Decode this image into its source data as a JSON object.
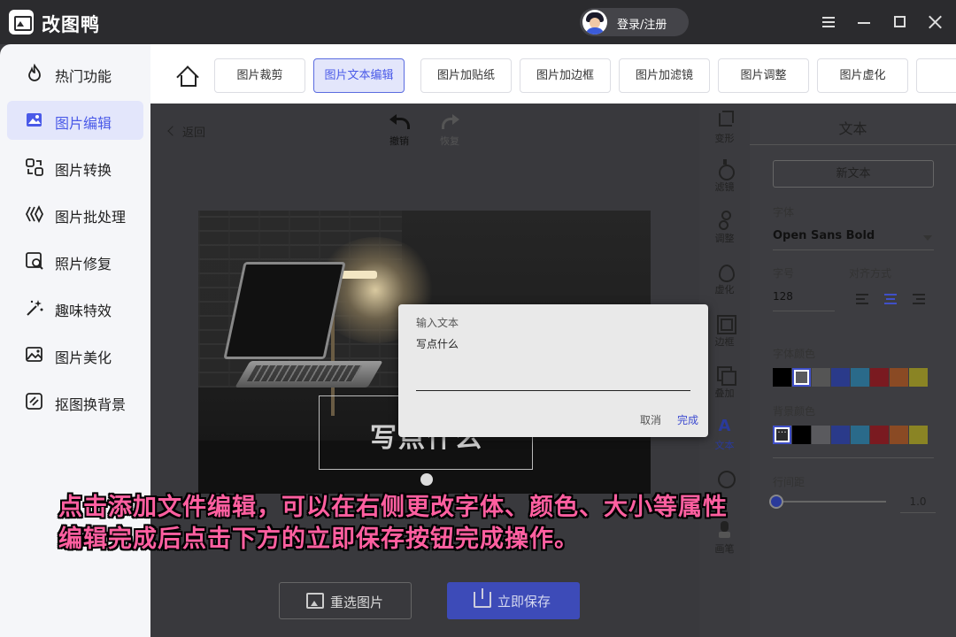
{
  "app": {
    "title": "改图鸭",
    "login_label": "登录/注册"
  },
  "sidebar": {
    "items": [
      {
        "label": "热门功能",
        "icon": "flame-icon"
      },
      {
        "label": "图片编辑",
        "icon": "image-edit-icon",
        "active": true
      },
      {
        "label": "图片转换",
        "icon": "convert-icon"
      },
      {
        "label": "图片批处理",
        "icon": "batch-icon"
      },
      {
        "label": "照片修复",
        "icon": "repair-icon"
      },
      {
        "label": "趣味特效",
        "icon": "magic-icon"
      },
      {
        "label": "图片美化",
        "icon": "beautify-icon"
      },
      {
        "label": "抠图换背景",
        "icon": "cutout-icon"
      }
    ]
  },
  "tabs": [
    {
      "label": "图片裁剪"
    },
    {
      "label": "图片文本编辑",
      "active": true
    },
    {
      "label": "图片加贴纸"
    },
    {
      "label": "图片加边框"
    },
    {
      "label": "图片加滤镜"
    },
    {
      "label": "图片调整"
    },
    {
      "label": "图片虚化"
    }
  ],
  "workspace": {
    "back_label": "返回",
    "undo_label": "撤销",
    "redo_label": "恢复",
    "canvas_text": "写点什么",
    "reselect_label": "重选图片",
    "save_label": "立即保存"
  },
  "tools": [
    {
      "label": "变形",
      "icon": "crop-icon"
    },
    {
      "label": "滤镜",
      "icon": "filter-icon"
    },
    {
      "label": "调整",
      "icon": "adjust-icon"
    },
    {
      "label": "虚化",
      "icon": "blur-icon"
    },
    {
      "label": "边框",
      "icon": "border-icon"
    },
    {
      "label": "叠加",
      "icon": "overlay-icon"
    },
    {
      "label": "文本",
      "icon": "text-icon",
      "active": true
    },
    {
      "label": "",
      "icon": "sticker-icon"
    },
    {
      "label": "画笔",
      "icon": "brush-icon"
    }
  ],
  "panel": {
    "title": "文本",
    "new_text_label": "新文本",
    "font_label": "字体",
    "font_value": "Open Sans Bold",
    "size_label": "字号",
    "size_value": "128",
    "align_label": "对齐方式",
    "align_selected": "center",
    "font_color_label": "字体颜色",
    "font_colors": [
      "#000000",
      "#ffffff",
      "#8c8c8c",
      "#3a55c8",
      "#3a9ad0",
      "#c0202a",
      "#d0602a",
      "#e0d030"
    ],
    "bg_color_label": "背景颜色",
    "bg_colors": [
      "none",
      "#000000",
      "#ffffff",
      "#3a55c8",
      "#3a9ad0",
      "#c0202a",
      "#d0602a",
      "#e0d030"
    ],
    "line_spacing_label": "行间距",
    "line_spacing_value": "1.0"
  },
  "dialog": {
    "title": "输入文本",
    "input_value": "写点什么",
    "cancel_label": "取消",
    "ok_label": "完成"
  },
  "caption": {
    "line1": "点击添加文件编辑，可以在右侧更改字体、颜色、大小等属性",
    "line2": "编辑完成后点击下方的立即保存按钮完成操作。"
  }
}
